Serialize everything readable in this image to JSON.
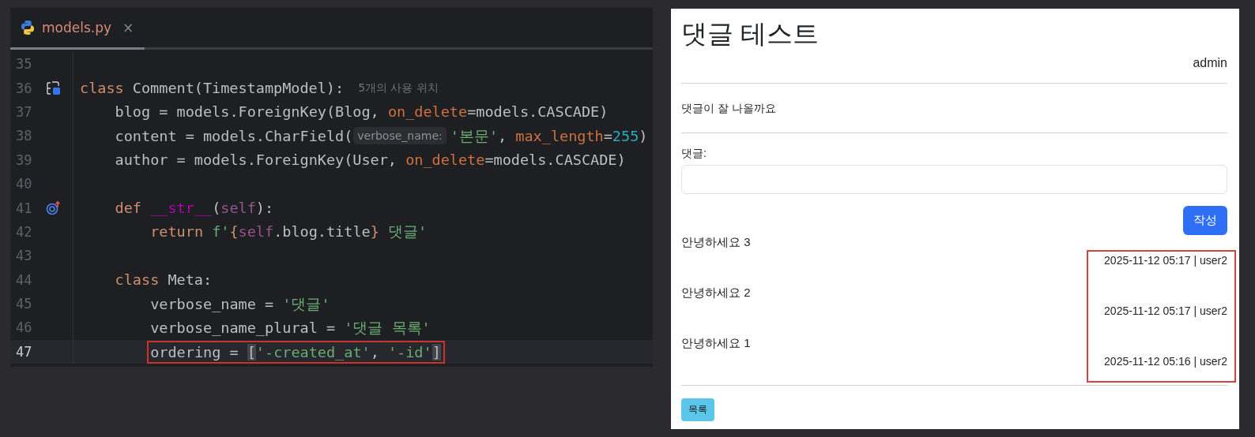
{
  "editor": {
    "tab": {
      "label": "models.py",
      "close": "×"
    },
    "lines": [
      {
        "number": "35"
      },
      {
        "number": "36",
        "kind": "model",
        "tokens": [
          {
            "kind": "kw",
            "text": "class "
          },
          {
            "kind": "plain",
            "text": "Comment(TimestampModel):"
          },
          {
            "kind": "hint",
            "text": "5개의 사용 위치"
          }
        ],
        "children": [
          {
            "number": "37",
            "tokens": [
              {
                "kind": "plain",
                "text": "blog = models.ForeignKey(Blog, "
              },
              {
                "kind": "param",
                "text": "on_delete"
              },
              {
                "kind": "plain",
                "text": "=models.CASCADE)"
              }
            ]
          },
          {
            "number": "38",
            "tokens": [
              {
                "kind": "plain",
                "text": "content = models.CharField("
              },
              {
                "kind": "inlay",
                "text": "verbose_name:"
              },
              {
                "kind": "str",
                "text": "'본문'"
              },
              {
                "kind": "plain",
                "text": ", "
              },
              {
                "kind": "param",
                "text": "max_length"
              },
              {
                "kind": "plain",
                "text": "="
              },
              {
                "kind": "num",
                "text": "255"
              },
              {
                "kind": "plain",
                "text": ")"
              }
            ]
          },
          {
            "number": "39",
            "tokens": [
              {
                "kind": "plain",
                "text": "author = models.ForeignKey(User, "
              },
              {
                "kind": "param",
                "text": "on_delete"
              },
              {
                "kind": "plain",
                "text": "=models.CASCADE)"
              }
            ]
          },
          {
            "number": "40"
          },
          {
            "number": "41",
            "kind": "override",
            "tokens": [
              {
                "kind": "kw",
                "text": "def "
              },
              {
                "kind": "dunder",
                "text": "__str__"
              },
              {
                "kind": "plain",
                "text": "("
              },
              {
                "kind": "self",
                "text": "self"
              },
              {
                "kind": "plain",
                "text": "):"
              }
            ],
            "children": [
              {
                "number": "42",
                "tokens": [
                  {
                    "kind": "kw",
                    "text": "return "
                  },
                  {
                    "kind": "str",
                    "text": "f'"
                  },
                  {
                    "kind": "brace",
                    "text": "{"
                  },
                  {
                    "kind": "self",
                    "text": "self"
                  },
                  {
                    "kind": "plain",
                    "text": ".blog.title"
                  },
                  {
                    "kind": "brace",
                    "text": "}"
                  },
                  {
                    "kind": "str",
                    "text": " 댓글'"
                  }
                ]
              }
            ]
          },
          {
            "number": "43"
          },
          {
            "number": "44",
            "tokens": [
              {
                "kind": "kw",
                "text": "class "
              },
              {
                "kind": "plain",
                "text": "Meta:"
              }
            ],
            "children": [
              {
                "number": "45",
                "tokens": [
                  {
                    "kind": "plain",
                    "text": "verbose_name = "
                  },
                  {
                    "kind": "str",
                    "text": "'댓글'"
                  }
                ]
              },
              {
                "number": "46",
                "tokens": [
                  {
                    "kind": "plain",
                    "text": "verbose_name_plural = "
                  },
                  {
                    "kind": "str",
                    "text": "'댓글 목록'"
                  }
                ]
              },
              {
                "number": "47",
                "current": true,
                "boxed": true,
                "tokens": [
                  {
                    "kind": "plain",
                    "text": "ordering = "
                  },
                  {
                    "kind": "match",
                    "text": "["
                  },
                  {
                    "kind": "str",
                    "text": "'-created_at'"
                  },
                  {
                    "kind": "plain",
                    "text": ", "
                  },
                  {
                    "kind": "str",
                    "text": "'-id'"
                  },
                  {
                    "kind": "match",
                    "text": "]"
                  }
                ]
              }
            ]
          }
        ]
      }
    ]
  },
  "page": {
    "title": "댓글 테스트",
    "user": "admin",
    "content": "댓글이 잘 나올까요",
    "form": {
      "label": "댓글:",
      "submit": "작성"
    },
    "comments_highlighted": true,
    "comments": [
      {
        "text": "안녕하세요 3",
        "meta": "2025-11-12 05:17 | user2"
      },
      {
        "text": "안녕하세요 2",
        "meta": "2025-11-12 05:17 | user2"
      },
      {
        "text": "안녕하세요 1",
        "meta": "2025-11-12 05:16 | user2"
      }
    ],
    "back": "목록"
  }
}
